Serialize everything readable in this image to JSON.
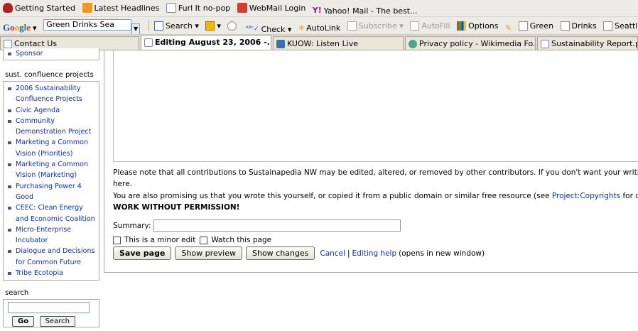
{
  "bookmarks": [
    {
      "label": "Getting Started",
      "icon": "getting-started-icon"
    },
    {
      "label": "Latest Headlines",
      "icon": "rss-icon"
    },
    {
      "label": "Furl It no-pop",
      "icon": "page-icon"
    },
    {
      "label": "WebMail Login",
      "icon": "mail-icon"
    },
    {
      "label": "Yahoo! Mail - The best...",
      "icon": "yahoo-icon"
    }
  ],
  "google_toolbar": {
    "search_value": "Green Drinks Sea",
    "search_label": "Search",
    "check_label": "Check",
    "autolink_label": "AutoLink",
    "subscribe_label": "Subscribe",
    "autofill_label": "AutoFill",
    "options_label": "Options",
    "highlights": [
      "Green",
      "Drinks",
      "Seattle"
    ]
  },
  "tabs": [
    {
      "label": "Contact Us",
      "active": false
    },
    {
      "label": "Editing August 23, 2006 -...",
      "active": true
    },
    {
      "label": "KUOW: Listen Live",
      "active": false
    },
    {
      "label": "Privacy policy - Wikimedia Fo...",
      "active": false
    },
    {
      "label": "Sustainability Report.pd",
      "active": false
    }
  ],
  "sidebar": {
    "sponsor_label": "Sponsor",
    "projects_heading": "sust. confluence projects",
    "projects": [
      "2006 Sustainability Confluence Projects",
      "Civic Agenda",
      "Community Demonstration Project",
      "Marketing a Common Vision (Priorities)",
      "Marketing a Common Vision (Marketing)",
      "Purchasing Power 4 Good",
      "CEEC: Clean Energy and Economic Coalition",
      "Micro-Enterprise Incubator",
      "Dialogue and Decisions for Common Future",
      "Tribe Ecotopia"
    ],
    "search_heading": "search",
    "go_label": "Go",
    "search_label": "Search"
  },
  "editor": {
    "note1": "Please note that all contributions to Sustainapedia NW may be edited, altered, or removed by other contributors. If you don't want your writing t",
    "note1b": "here.",
    "note2_pre": "You are also promising us that you wrote this yourself, or copied it from a public domain or similar free resource (see ",
    "note2_link": "Project:Copyrights",
    "note2_post": " for det",
    "warning": "WORK WITHOUT PERMISSION!",
    "summary_label": "Summary:",
    "minor_edit_label": "This is a minor edit",
    "watch_label": "Watch this page",
    "save_label": "Save page",
    "preview_label": "Show preview",
    "changes_label": "Show changes",
    "cancel_label": "Cancel",
    "separator": "|",
    "help_label": "Editing help",
    "help_suffix": "(opens in new window)"
  }
}
